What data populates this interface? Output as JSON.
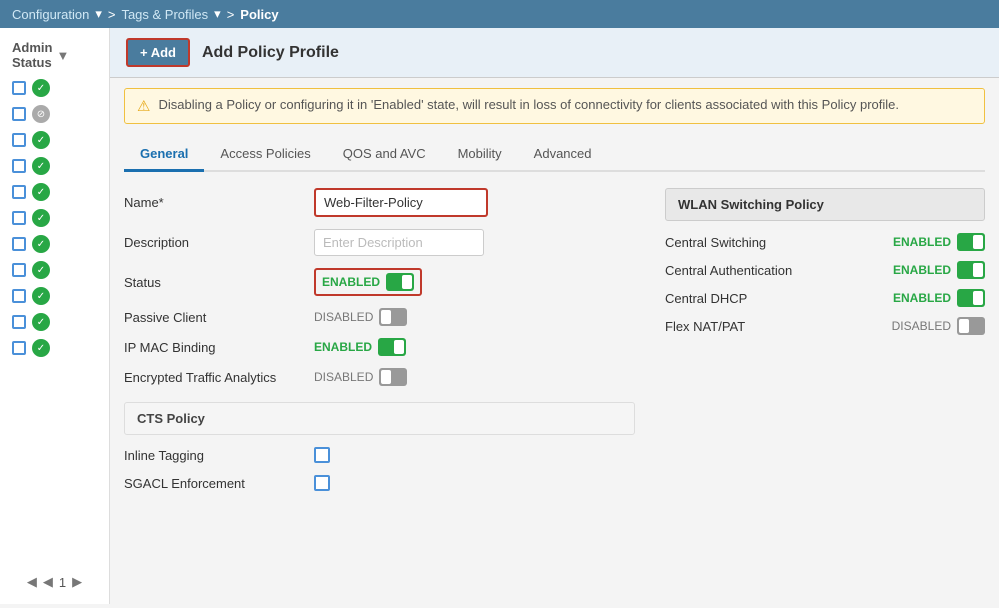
{
  "nav": {
    "config": "Configuration",
    "config_arrow": "▾",
    "sep1": ">",
    "tags": "Tags & Profiles",
    "tags_arrow": "▾",
    "sep2": ">",
    "current": "Policy"
  },
  "add_button": "+ Add",
  "panel_title": "Add Policy Profile",
  "warning_text": "Disabling a Policy or configuring it in 'Enabled' state, will result in loss of connectivity for clients associated with this Policy profile.",
  "tabs": {
    "general": "General",
    "access_policies": "Access Policies",
    "qos_avc": "QOS and AVC",
    "mobility": "Mobility",
    "advanced": "Advanced"
  },
  "form": {
    "name_label": "Name*",
    "name_value": "Web-Filter-Policy",
    "description_label": "Description",
    "description_placeholder": "Enter Description",
    "status_label": "Status",
    "status_enabled": "ENABLED",
    "passive_client_label": "Passive Client",
    "passive_disabled": "DISABLED",
    "ip_mac_label": "IP MAC Binding",
    "ip_mac_enabled": "ENABLED",
    "eta_label": "Encrypted Traffic Analytics",
    "eta_disabled": "DISABLED",
    "cts_title": "CTS Policy",
    "inline_tagging": "Inline Tagging",
    "sgacl_enforcement": "SGACL Enforcement"
  },
  "wlan": {
    "title": "WLAN Switching Policy",
    "central_switching": "Central Switching",
    "central_switching_status": "ENABLED",
    "central_auth": "Central Authentication",
    "central_auth_status": "ENABLED",
    "central_dhcp": "Central DHCP",
    "central_dhcp_status": "ENABLED",
    "flex_nat": "Flex NAT/PAT",
    "flex_nat_status": "DISABLED"
  },
  "sidebar": {
    "rows": [
      {
        "status": "green"
      },
      {
        "status": "grey"
      },
      {
        "status": "green"
      },
      {
        "status": "green"
      },
      {
        "status": "green"
      },
      {
        "status": "green"
      },
      {
        "status": "green"
      },
      {
        "status": "green"
      },
      {
        "status": "green"
      },
      {
        "status": "green"
      },
      {
        "status": "green"
      }
    ],
    "page": "1"
  }
}
